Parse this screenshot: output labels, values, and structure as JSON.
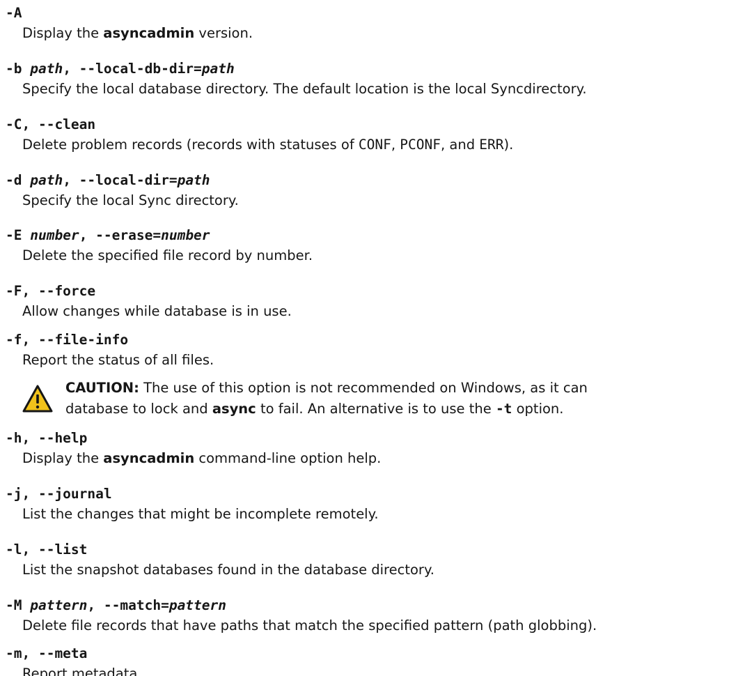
{
  "options": [
    {
      "term": [
        {
          "t": "-A"
        }
      ],
      "desc": [
        {
          "t": "Display the "
        },
        {
          "t": "asyncadmin",
          "s": "b"
        },
        {
          "t": " version."
        }
      ]
    },
    {
      "term": [
        {
          "t": "-b "
        },
        {
          "t": "path",
          "s": "i"
        },
        {
          "t": ", --local-db-dir="
        },
        {
          "t": "path",
          "s": "i"
        }
      ],
      "desc": [
        {
          "t": "Specify the local database directory. The default location is the local Syncdirectory."
        }
      ]
    },
    {
      "term": [
        {
          "t": "-C, --clean"
        }
      ],
      "desc": [
        {
          "t": "Delete problem records (records with statuses of "
        },
        {
          "t": "CONF",
          "s": "m"
        },
        {
          "t": ", "
        },
        {
          "t": "PCONF",
          "s": "m"
        },
        {
          "t": ", and "
        },
        {
          "t": "ERR",
          "s": "m"
        },
        {
          "t": ")."
        }
      ]
    },
    {
      "term": [
        {
          "t": "-d "
        },
        {
          "t": "path",
          "s": "i"
        },
        {
          "t": ", --local-dir="
        },
        {
          "t": "path",
          "s": "i"
        }
      ],
      "desc": [
        {
          "t": "Specify the local Sync directory."
        }
      ]
    },
    {
      "term": [
        {
          "t": "-E "
        },
        {
          "t": "number",
          "s": "i"
        },
        {
          "t": ", --erase="
        },
        {
          "t": "number",
          "s": "i"
        }
      ],
      "desc": [
        {
          "t": "Delete the specified file record by number."
        }
      ]
    },
    {
      "term": [
        {
          "t": "-F, --force"
        }
      ],
      "desc": [
        {
          "t": "Allow changes while database is in use."
        }
      ]
    },
    {
      "term": [
        {
          "t": "-f, --file-info"
        }
      ],
      "desc": [
        {
          "t": "Report the status of all files."
        }
      ]
    },
    {
      "term": [
        {
          "t": "-h, --help"
        }
      ],
      "desc": [
        {
          "t": "Display the "
        },
        {
          "t": "asyncadmin",
          "s": "b"
        },
        {
          "t": " command-line option help."
        }
      ]
    },
    {
      "term": [
        {
          "t": "-j, --journal"
        }
      ],
      "desc": [
        {
          "t": "List the changes that might be incomplete remotely."
        }
      ]
    },
    {
      "term": [
        {
          "t": "-l, --list"
        }
      ],
      "desc": [
        {
          "t": "List the snapshot databases found in the database directory."
        }
      ]
    },
    {
      "term": [
        {
          "t": "-M "
        },
        {
          "t": "pattern",
          "s": "i"
        },
        {
          "t": ", --match="
        },
        {
          "t": "pattern",
          "s": "i"
        }
      ],
      "desc": [
        {
          "t": "Delete file records that have paths that match the specified pattern (path globbing)."
        }
      ]
    },
    {
      "term": [
        {
          "t": "-m, --meta"
        }
      ],
      "desc": [
        {
          "t": "Report metadata."
        }
      ]
    }
  ],
  "caution": {
    "icon": "warning-triangle-icon",
    "label": "CAUTION:",
    "line1": " The use of this option is not recommended on Windows, as it can",
    "line2": [
      {
        "t": "database to lock and "
      },
      {
        "t": "async",
        "s": "b"
      },
      {
        "t": " to fail. An alternative is to use the "
      },
      {
        "t": "-t",
        "s": "mb"
      },
      {
        "t": " option."
      }
    ]
  },
  "colors": {
    "text": "#161616",
    "warning_fill": "#f1c21b",
    "warning_outline": "#161616"
  }
}
